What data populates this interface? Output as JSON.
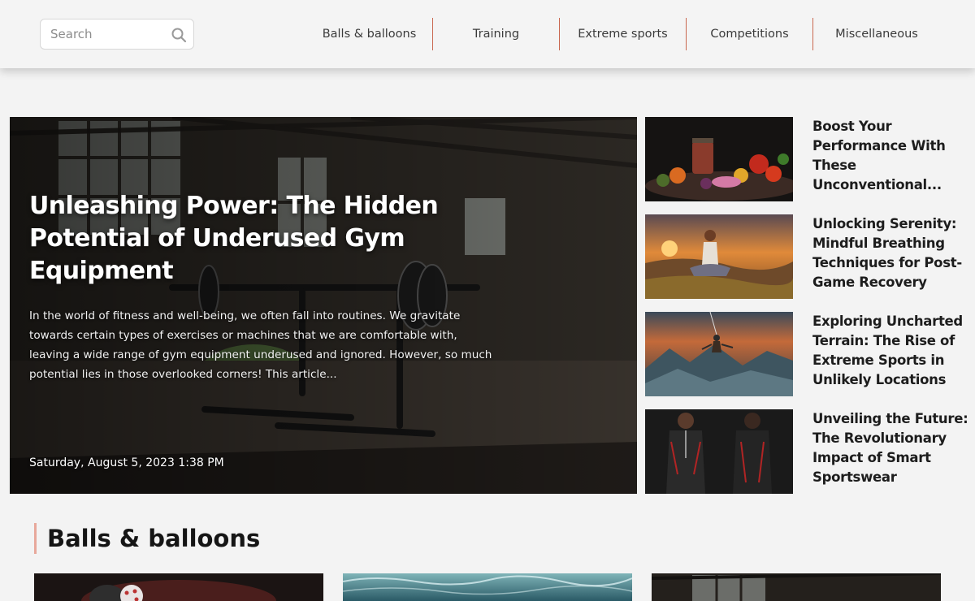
{
  "header": {
    "search": {
      "placeholder": "Search",
      "icon": "search-icon"
    },
    "nav": [
      {
        "label": "Balls & balloons"
      },
      {
        "label": "Training"
      },
      {
        "label": "Extreme sports"
      },
      {
        "label": "Competitions"
      },
      {
        "label": "Miscellaneous"
      }
    ],
    "divider_color": "#c9674f"
  },
  "hero": {
    "title": "Unleashing Power: The Hidden Potential of Underused Gym Equipment",
    "excerpt": "In the world of fitness and well-being, we often fall into routines. We gravitate towards certain types of exercises or machines that we are comfortable with, leaving a wide range of gym equipment underused and ignored. However, so much potential lies in those overlooked corners! This article...",
    "date": "Saturday, August 5, 2023 1:38 PM"
  },
  "side_articles": [
    {
      "title": "Boost Your Performance With These Unconventional..."
    },
    {
      "title": "Unlocking Serenity: Mindful Breathing Techniques for Post-Game Recovery"
    },
    {
      "title": "Exploring Uncharted Terrain: The Rise of Extreme Sports in Unlikely Locations"
    },
    {
      "title": "Unveiling the Future: The Revolutionary Impact of Smart Sportswear"
    }
  ],
  "section": {
    "title": "Balls & balloons",
    "accent_color": "#e8a89b"
  }
}
